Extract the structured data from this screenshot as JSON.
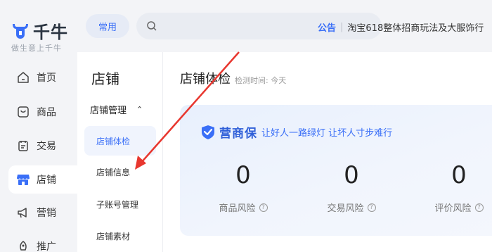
{
  "brand": {
    "name": "千牛",
    "slogan": "做生意上千牛"
  },
  "leftnav": [
    {
      "label": "首页",
      "icon": "home-icon"
    },
    {
      "label": "商品",
      "icon": "product-icon"
    },
    {
      "label": "交易",
      "icon": "trade-icon"
    },
    {
      "label": "店铺",
      "icon": "shop-icon",
      "active": true
    },
    {
      "label": "营销",
      "icon": "megaphone-icon"
    },
    {
      "label": "推广",
      "icon": "promo-icon"
    }
  ],
  "topbar": {
    "chip_label": "常用",
    "search_placeholder": "",
    "notice_label": "公告",
    "notice_text": "淘宝618整体招商玩法及大服饰行"
  },
  "subnav": {
    "title": "店铺",
    "group": "店铺管理",
    "items": [
      "店铺体检",
      "店铺信息",
      "子账号管理",
      "店铺素材"
    ],
    "active_index": 0
  },
  "main": {
    "title": "店铺体检",
    "subtitle": "检测时间: 今天",
    "card": {
      "brand_name": "营商保",
      "brand_slogan": "让好人一路绿灯 让坏人寸步难行",
      "metrics": [
        {
          "value": "0",
          "label": "商品风险"
        },
        {
          "value": "0",
          "label": "交易风险"
        },
        {
          "value": "0",
          "label": "评价风险"
        }
      ]
    }
  },
  "colors": {
    "accent": "#3a6ff7",
    "arrow": "#e8372f",
    "nav_bg": "#f3f4f7"
  }
}
